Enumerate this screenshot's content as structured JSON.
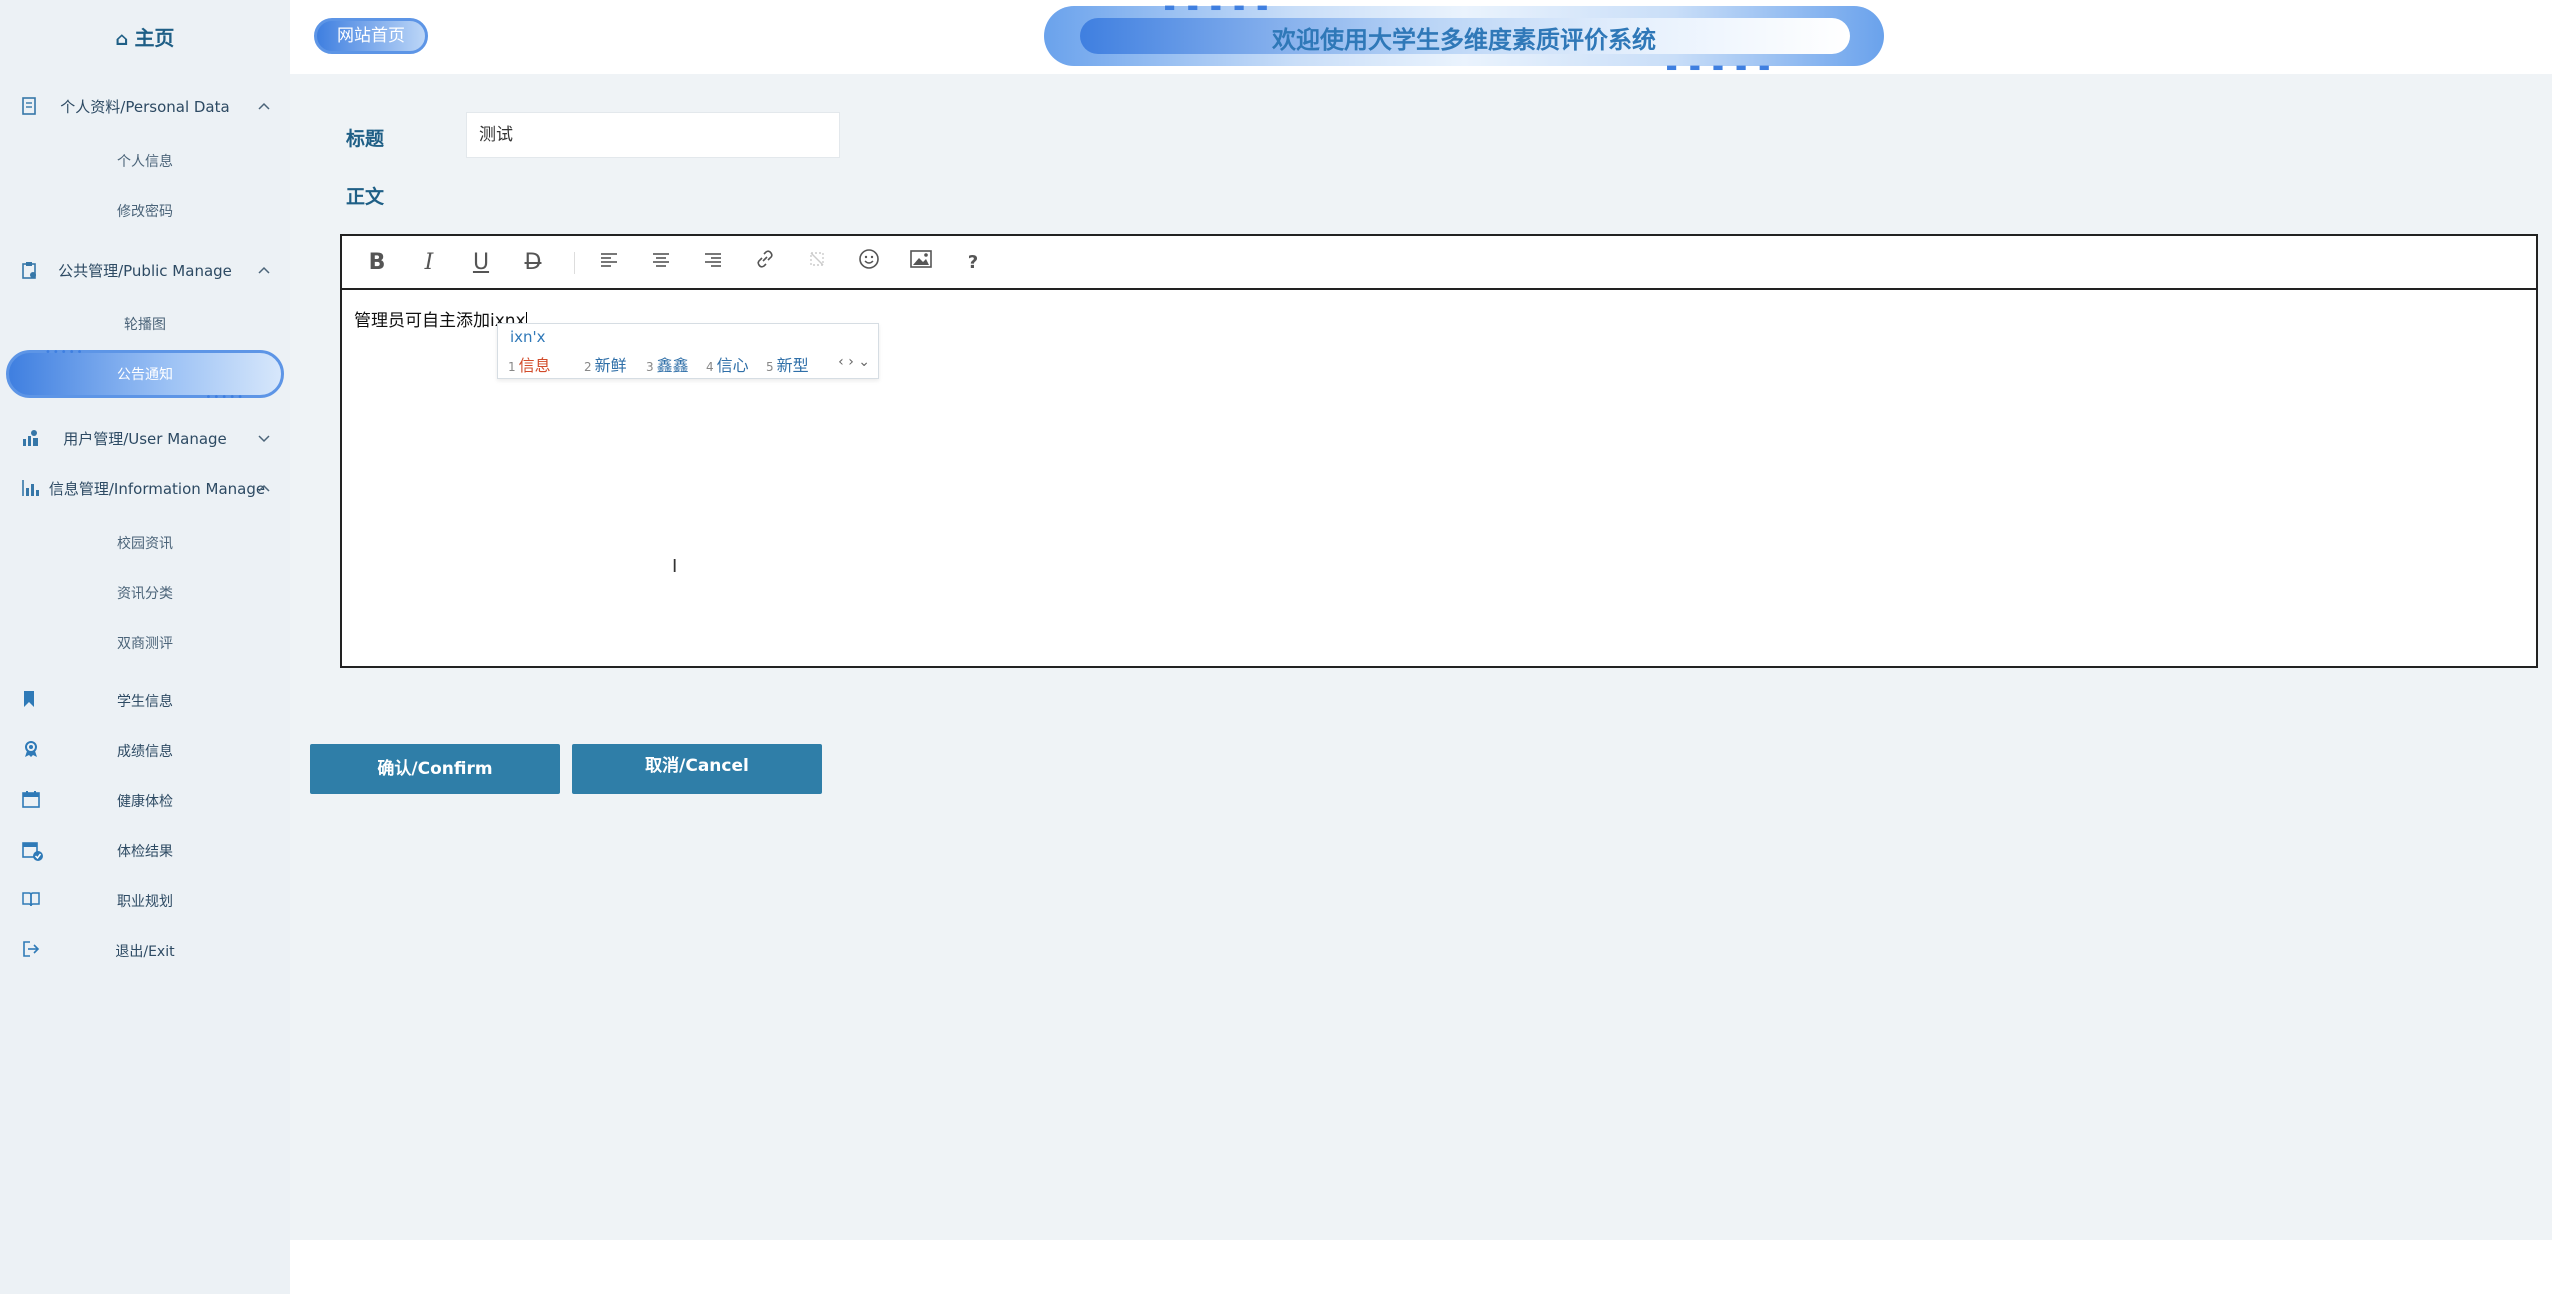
{
  "sidebar": {
    "home_label": "主页",
    "groups": [
      {
        "label": "个人资料/Personal Data",
        "icon": "document-icon",
        "expanded": true,
        "items": [
          "个人信息",
          "修改密码"
        ]
      },
      {
        "label": "公共管理/Public Manage",
        "icon": "clipboard-icon",
        "expanded": true,
        "items": [
          "轮播图",
          "公告通知"
        ]
      },
      {
        "label": "用户管理/User Manage",
        "icon": "users-icon",
        "expanded": false,
        "items": []
      },
      {
        "label": "信息管理/Information Manage",
        "icon": "chart-icon",
        "expanded": true,
        "items": [
          "校园资讯",
          "资讯分类",
          "双商测评"
        ]
      }
    ],
    "active_item": "公告通知",
    "plain_items": [
      {
        "label": "学生信息",
        "icon": "bookmark-icon"
      },
      {
        "label": "成绩信息",
        "icon": "award-icon"
      },
      {
        "label": "健康体检",
        "icon": "calendar-icon"
      },
      {
        "label": "体检结果",
        "icon": "calendar-check-icon"
      },
      {
        "label": "职业规划",
        "icon": "book-icon"
      },
      {
        "label": "退出/Exit",
        "icon": "exit-icon"
      }
    ]
  },
  "header": {
    "site_home": "网站首页",
    "banner_title": "欢迎使用大学生多维度素质评价系统"
  },
  "form": {
    "title_label": "标题",
    "title_value": "测试",
    "body_label": "正文",
    "body_text": "管理员可自主添加ixnx"
  },
  "toolbar": [
    "bold-icon",
    "italic-icon",
    "underline-icon",
    "strikethrough-icon",
    "align-left-icon",
    "align-center-icon",
    "align-right-icon",
    "link-icon",
    "unlink-icon",
    "emoji-icon",
    "image-icon",
    "help-icon"
  ],
  "ime": {
    "pinyin": "ixn'x",
    "candidates": [
      {
        "n": "1",
        "text": "信息"
      },
      {
        "n": "2",
        "text": "新鲜"
      },
      {
        "n": "3",
        "text": "鑫鑫"
      },
      {
        "n": "4",
        "text": "信心"
      },
      {
        "n": "5",
        "text": "新型"
      }
    ]
  },
  "buttons": {
    "confirm": "确认/Confirm",
    "cancel": "取消/Cancel"
  },
  "colors": {
    "accent": "#2f7ea8",
    "sidebar_bg": "#ecf1f5",
    "main_bg": "#eff3f6",
    "title_blue": "#1f5f86"
  }
}
